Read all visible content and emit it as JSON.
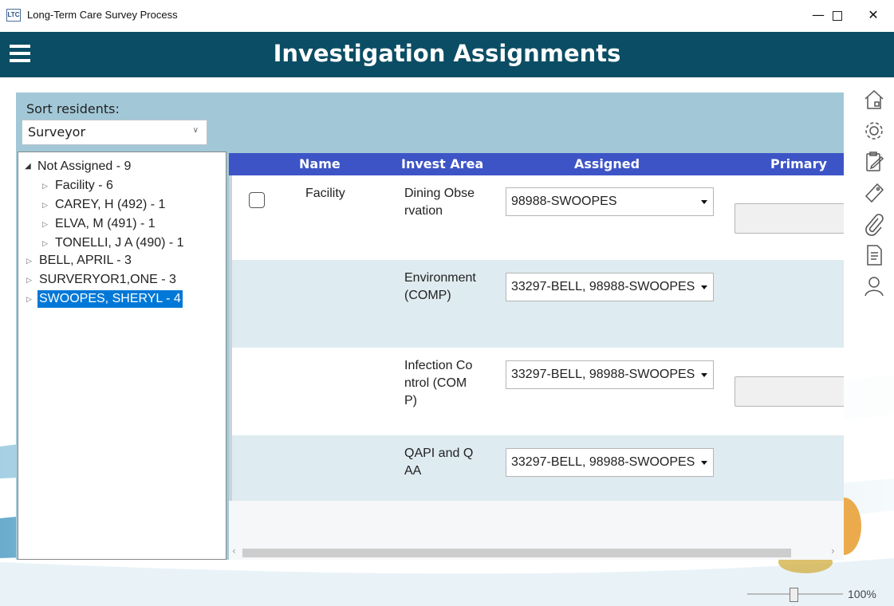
{
  "window": {
    "app_icon_text": "LTC",
    "title": "Long-Term Care Survey Process",
    "minimize": "—",
    "close": "✕"
  },
  "header": {
    "title": "Investigation Assignments",
    "menu_icon": "hamburger-menu-icon"
  },
  "rail": {
    "icons": [
      "home-icon",
      "gear-icon",
      "clipboard-edit-icon",
      "tag-icon",
      "paperclip-icon",
      "report-document-icon",
      "person-icon"
    ]
  },
  "sort": {
    "label": "Sort residents:",
    "selected": "Surveyor"
  },
  "tree": {
    "items": [
      {
        "label": "Not Assigned - 9",
        "expanded": true
      },
      {
        "label": "Facility - 6"
      },
      {
        "label": "CAREY, H  (492) - 1"
      },
      {
        "label": "ELVA, M  (491) - 1"
      },
      {
        "label": "TONELLI, J A (490) - 1"
      },
      {
        "label": "BELL, APRIL - 3"
      },
      {
        "label": "SURVERYOR1,ONE - 3"
      },
      {
        "label": "SWOOPES, SHERYL - 4",
        "selected": true
      }
    ]
  },
  "grid": {
    "columns": [
      "Name",
      "Invest Area",
      "Assigned",
      "Primary"
    ],
    "rows": [
      {
        "name": "Facility",
        "area": "Dining Observation",
        "assigned": "98988-SWOOPES"
      },
      {
        "name": "",
        "area": "Environment (COMP)",
        "assigned": "33297-BELL, 98988-SWOOPES"
      },
      {
        "name": "",
        "area": "Infection Control (COMP)",
        "assigned": "33297-BELL, 98988-SWOOPES"
      },
      {
        "name": "",
        "area": "QAPI and QAA",
        "assigned": "33297-BELL, 98988-SWOOPES"
      }
    ]
  },
  "zoom": {
    "level": "100%"
  },
  "colors": {
    "header_bg": "#0b4d64",
    "panel_bg": "#a2c8d7",
    "grid_header_bg": "#3d54c6",
    "selection": "#0078d7"
  }
}
